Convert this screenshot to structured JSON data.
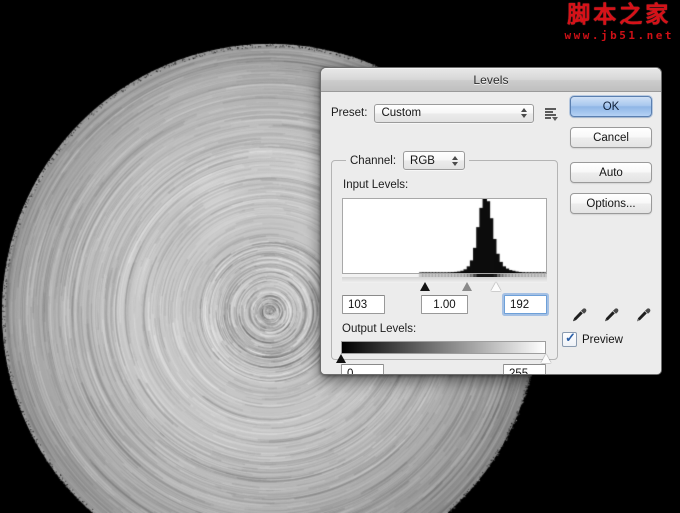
{
  "watermark": {
    "brand": "脚本之家",
    "url": "www.jb51.net",
    "color": "#d61118"
  },
  "dialog": {
    "title": "Levels",
    "preset": {
      "label": "Preset:",
      "value": "Custom",
      "menu_icon": "preset-options-icon"
    },
    "channel": {
      "label": "Channel:",
      "value": "RGB"
    },
    "input_levels": {
      "label": "Input Levels:",
      "black": "103",
      "gamma": "1.00",
      "white": "192",
      "black_pos_pct": 40.4,
      "gamma_pos_pct": 61.2,
      "white_pos_pct": 75.3,
      "focused_field": "white"
    },
    "output_levels": {
      "label": "Output Levels:",
      "black": "0",
      "white": "255",
      "black_pos_pct": 0,
      "white_pos_pct": 100
    },
    "buttons": {
      "ok": "OK",
      "cancel": "Cancel",
      "auto": "Auto",
      "options": "Options..."
    },
    "eyedroppers": [
      "eyedropper-black-point-icon",
      "eyedropper-gray-point-icon",
      "eyedropper-white-point-icon"
    ],
    "preview": {
      "label": "Preview",
      "checked": true,
      "check_glyph": "✓"
    },
    "accent_color": "#8fb6e6"
  },
  "background": {
    "description": "radial-blurred brushed metal disc on black",
    "disc_center_x": 270,
    "disc_center_y": 312,
    "disc_radius": 268,
    "canvas_color": "#000000"
  },
  "chart_data": {
    "type": "bar",
    "title": "Input Levels histogram",
    "xlabel": "",
    "ylabel": "",
    "xlim": [
      0,
      255
    ],
    "ylim": [
      0,
      1
    ],
    "grid": false,
    "legend": null,
    "categories": [
      0,
      4,
      8,
      12,
      16,
      20,
      24,
      28,
      32,
      36,
      40,
      44,
      48,
      52,
      56,
      60,
      64,
      68,
      72,
      76,
      80,
      84,
      88,
      92,
      96,
      100,
      104,
      108,
      112,
      116,
      120,
      124,
      128,
      132,
      136,
      140,
      144,
      148,
      152,
      156,
      160,
      164,
      168,
      172,
      176,
      180,
      184,
      188,
      192,
      196,
      200,
      204,
      208,
      212,
      216,
      220,
      224,
      228,
      232,
      236,
      240,
      244,
      248,
      252
    ],
    "values": [
      0,
      0,
      0,
      0,
      0,
      0,
      0,
      0,
      0,
      0,
      0,
      0,
      0,
      0,
      0,
      0,
      0,
      0,
      0,
      0,
      0,
      0,
      0,
      0,
      0.004,
      0.005,
      0.004,
      0.006,
      0.006,
      0.005,
      0.007,
      0.006,
      0.008,
      0.01,
      0.012,
      0.015,
      0.02,
      0.03,
      0.05,
      0.09,
      0.17,
      0.34,
      0.62,
      0.88,
      1.0,
      0.97,
      0.74,
      0.46,
      0.26,
      0.15,
      0.09,
      0.06,
      0.04,
      0.03,
      0.02,
      0.014,
      0.01,
      0.008,
      0.006,
      0.005,
      0.004,
      0.004,
      0.003,
      0.003
    ]
  }
}
